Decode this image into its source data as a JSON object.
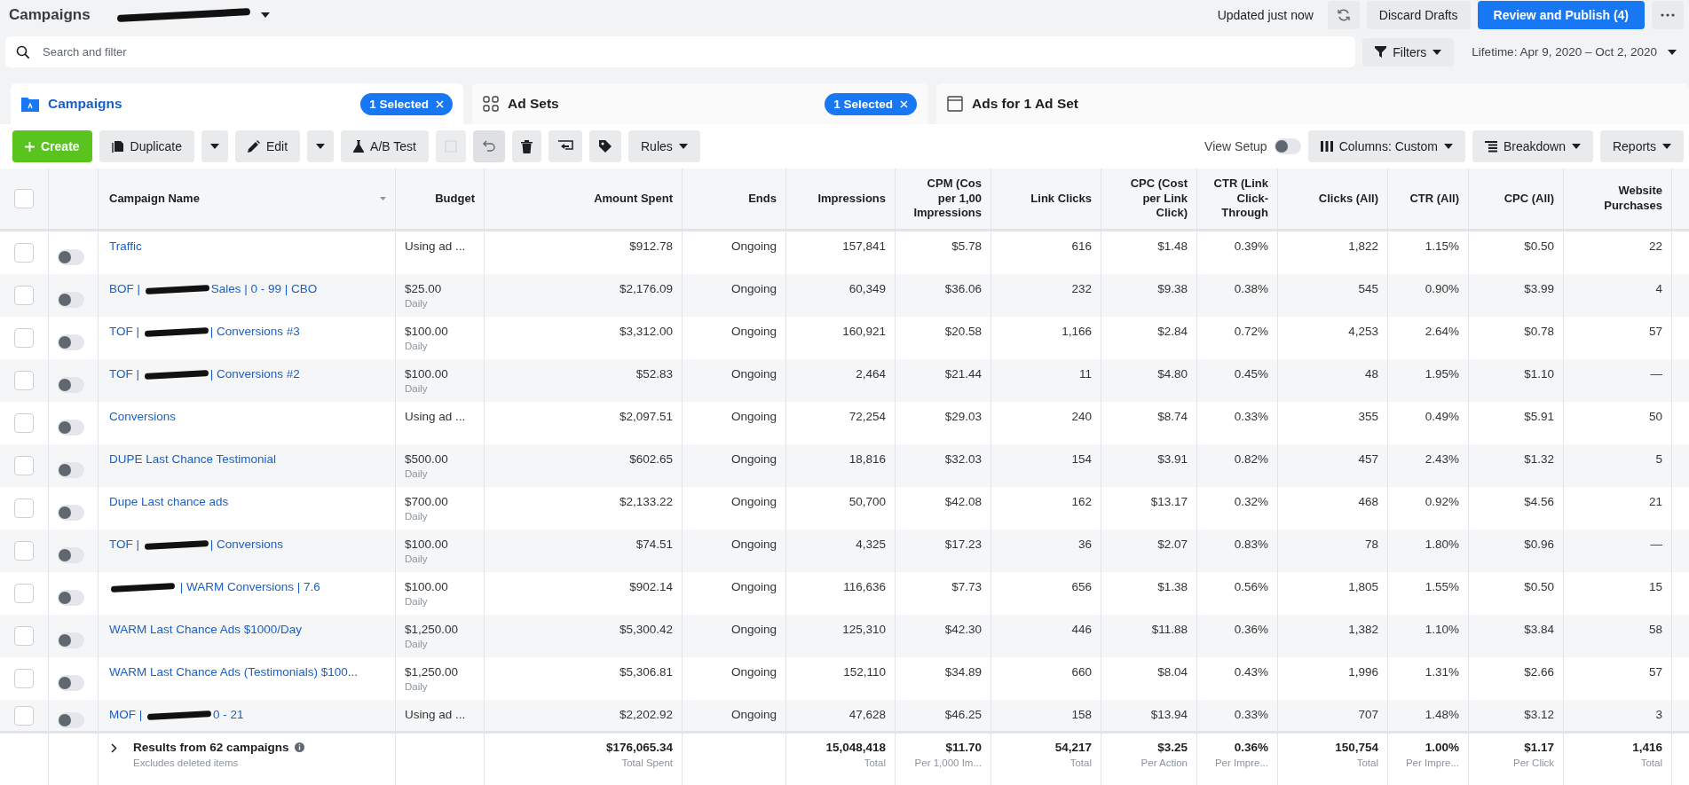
{
  "header": {
    "title": "Campaigns",
    "account_redacted": true,
    "status": "Updated just now",
    "discard": "Discard Drafts",
    "publish": "Review and Publish (4)"
  },
  "search": {
    "placeholder": "Search and filter",
    "filters": "Filters",
    "date_range": "Lifetime: Apr 9, 2020 – Oct 2, 2020"
  },
  "tabs": [
    {
      "label": "Campaigns",
      "selected": true,
      "badge": "1 Selected"
    },
    {
      "label": "Ad Sets",
      "selected": false,
      "badge": "1 Selected"
    },
    {
      "label": "Ads for 1 Ad Set",
      "selected": false
    }
  ],
  "toolbar": {
    "create": "Create",
    "duplicate": "Duplicate",
    "edit": "Edit",
    "ab_test": "A/B Test",
    "rules": "Rules",
    "view_setup": "View Setup",
    "view_setup_on": false,
    "columns": "Columns: Custom",
    "breakdown": "Breakdown",
    "reports": "Reports"
  },
  "select_all_checked": false,
  "columns": [
    "Campaign Name",
    "Budget",
    "Amount Spent",
    "Ends",
    "Impressions",
    "CPM (Cos\nper 1,00\nImpressions",
    "Link Clicks",
    "CPC (Cost\nper Link\nClick)",
    "CTR (Link\nClick-\nThrough",
    "Clicks (All)",
    "CTR (All)",
    "CPC (All)",
    "Website\nPurchases"
  ],
  "rows": [
    {
      "checked": false,
      "on": false,
      "name": [
        {
          "kind": "text",
          "text": "Traffic"
        }
      ],
      "budget": "Using ad ...",
      "cells": [
        "$912.78",
        "Ongoing",
        "157,841",
        "$5.78",
        "616",
        "$1.48",
        "0.39%",
        "1,822",
        "1.15%",
        "$0.50",
        "22"
      ]
    },
    {
      "checked": false,
      "on": false,
      "name": [
        {
          "kind": "text",
          "text": "BOF | "
        },
        {
          "kind": "redaction"
        },
        {
          "kind": "text",
          "text": "Sales | 0 - 99 | CBO"
        }
      ],
      "budget": "$25.00",
      "period": "Daily",
      "cells": [
        "$2,176.09",
        "Ongoing",
        "60,349",
        "$36.06",
        "232",
        "$9.38",
        "0.38%",
        "545",
        "0.90%",
        "$3.99",
        "4"
      ]
    },
    {
      "checked": false,
      "on": false,
      "name": [
        {
          "kind": "text",
          "text": "TOF | "
        },
        {
          "kind": "redaction"
        },
        {
          "kind": "text",
          "text": "| Conversions #3"
        }
      ],
      "budget": "$100.00",
      "period": "Daily",
      "cells": [
        "$3,312.00",
        "Ongoing",
        "160,921",
        "$20.58",
        "1,166",
        "$2.84",
        "0.72%",
        "4,253",
        "2.64%",
        "$0.78",
        "57"
      ]
    },
    {
      "checked": false,
      "on": false,
      "name": [
        {
          "kind": "text",
          "text": "TOF | "
        },
        {
          "kind": "redaction"
        },
        {
          "kind": "text",
          "text": "| Conversions #2"
        }
      ],
      "budget": "$100.00",
      "period": "Daily",
      "cells": [
        "$52.83",
        "Ongoing",
        "2,464",
        "$21.44",
        "11",
        "$4.80",
        "0.45%",
        "48",
        "1.95%",
        "$1.10",
        "—"
      ]
    },
    {
      "checked": false,
      "on": false,
      "name": [
        {
          "kind": "text",
          "text": "Conversions"
        }
      ],
      "budget": "Using ad ...",
      "cells": [
        "$2,097.51",
        "Ongoing",
        "72,254",
        "$29.03",
        "240",
        "$8.74",
        "0.33%",
        "355",
        "0.49%",
        "$5.91",
        "50"
      ]
    },
    {
      "checked": false,
      "on": false,
      "name": [
        {
          "kind": "text",
          "text": "DUPE Last Chance Testimonial"
        }
      ],
      "budget": "$500.00",
      "period": "Daily",
      "cells": [
        "$602.65",
        "Ongoing",
        "18,816",
        "$32.03",
        "154",
        "$3.91",
        "0.82%",
        "457",
        "2.43%",
        "$1.32",
        "5"
      ]
    },
    {
      "checked": false,
      "on": false,
      "name": [
        {
          "kind": "text",
          "text": "Dupe Last chance ads"
        }
      ],
      "budget": "$700.00",
      "period": "Daily",
      "cells": [
        "$2,133.22",
        "Ongoing",
        "50,700",
        "$42.08",
        "162",
        "$13.17",
        "0.32%",
        "468",
        "0.92%",
        "$4.56",
        "21"
      ]
    },
    {
      "checked": false,
      "on": false,
      "name": [
        {
          "kind": "text",
          "text": "TOF | "
        },
        {
          "kind": "redaction"
        },
        {
          "kind": "text",
          "text": "| Conversions"
        }
      ],
      "budget": "$100.00",
      "period": "Daily",
      "cells": [
        "$74.51",
        "Ongoing",
        "4,325",
        "$17.23",
        "36",
        "$2.07",
        "0.83%",
        "78",
        "1.80%",
        "$0.96",
        "—"
      ]
    },
    {
      "checked": false,
      "on": false,
      "name": [
        {
          "kind": "redaction"
        },
        {
          "kind": "text",
          "text": " | WARM Conversions | 7.6"
        }
      ],
      "budget": "$100.00",
      "period": "Daily",
      "cells": [
        "$902.14",
        "Ongoing",
        "116,636",
        "$7.73",
        "656",
        "$1.38",
        "0.56%",
        "1,805",
        "1.55%",
        "$0.50",
        "15"
      ]
    },
    {
      "checked": false,
      "on": false,
      "name": [
        {
          "kind": "text",
          "text": "WARM Last Chance Ads $1000/Day"
        }
      ],
      "budget": "$1,250.00",
      "period": "Daily",
      "cells": [
        "$5,300.42",
        "Ongoing",
        "125,310",
        "$42.30",
        "446",
        "$11.88",
        "0.36%",
        "1,382",
        "1.10%",
        "$3.84",
        "58"
      ]
    },
    {
      "checked": false,
      "on": false,
      "name": [
        {
          "kind": "text",
          "text": "WARM Last Chance Ads (Testimonials) $100..."
        }
      ],
      "budget": "$1,250.00",
      "period": "Daily",
      "cells": [
        "$5,306.81",
        "Ongoing",
        "152,110",
        "$34.89",
        "660",
        "$8.04",
        "0.43%",
        "1,996",
        "1.31%",
        "$2.66",
        "57"
      ]
    },
    {
      "checked": false,
      "on": false,
      "name": [
        {
          "kind": "text",
          "text": "MOF | "
        },
        {
          "kind": "redaction"
        },
        {
          "kind": "text",
          "text": "0 - 21"
        }
      ],
      "budget": "Using ad ...",
      "cells": [
        "$2,202.92",
        "Ongoing",
        "47,628",
        "$46.25",
        "158",
        "$13.94",
        "0.33%",
        "707",
        "1.48%",
        "$3.12",
        "3"
      ]
    }
  ],
  "footer": {
    "label": "Results from 62 campaigns",
    "note": "Excludes deleted items",
    "totals": [
      {
        "kind": "total",
        "value": "$176,065.34",
        "label": "Total Spent"
      },
      {
        "kind": "blank"
      },
      {
        "kind": "total",
        "value": "15,048,418",
        "label": "Total"
      },
      {
        "kind": "total",
        "value": "$11.70",
        "label": "Per 1,000 Im..."
      },
      {
        "kind": "total",
        "value": "54,217",
        "label": "Total"
      },
      {
        "kind": "total",
        "value": "$3.25",
        "label": "Per Action"
      },
      {
        "kind": "total",
        "value": "0.36%",
        "label": "Per Impre..."
      },
      {
        "kind": "total",
        "value": "150,754",
        "label": "Total"
      },
      {
        "kind": "total",
        "value": "1.00%",
        "label": "Per Impre..."
      },
      {
        "kind": "total",
        "value": "$1.17",
        "label": "Per Click"
      },
      {
        "kind": "total",
        "value": "1,416",
        "label": "Total"
      }
    ]
  }
}
